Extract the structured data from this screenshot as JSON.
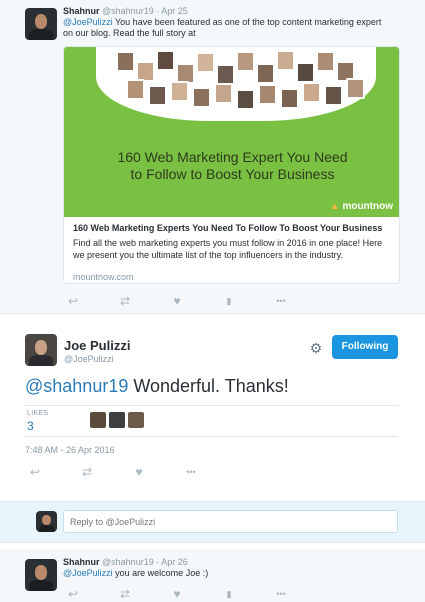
{
  "tweet1": {
    "name": "Shahnur",
    "handle": "@shahnur19",
    "separator": "·",
    "date": "Apr 25",
    "mention": "@JoePulizzi",
    "text_line1": " You have been featured as one of the top content marketing expert",
    "text_line2": "on our blog. Read the full story at",
    "card": {
      "image_headline_1": "160 Web Marketing Expert You Need",
      "image_headline_2": "to Follow to Boost Your Business",
      "brand": "mountnow",
      "brand_mark": "▲",
      "title": "160 Web Marketing Experts You Need To Follow To Boost Your Business",
      "description": "Find all the web marketing experts you must follow in 2016 in one place! Here we present you the ultimate list of the top influencers in the industry.",
      "domain": "mountnow.com"
    }
  },
  "main": {
    "name": "Joe Pulizzi",
    "handle": "@JoePulizzi",
    "follow_label": "Following",
    "mention": "@shahnur19",
    "text": " Wonderful.  Thanks!",
    "likes_label": "LIKES",
    "likes_count": "3",
    "timestamp": "7:48 AM - 26 Apr 2016"
  },
  "reply_box": {
    "placeholder": "Reply to @JoePulizzi"
  },
  "tweet2": {
    "name": "Shahnur",
    "handle": "@shahnur19",
    "separator": "·",
    "date": "Apr 26",
    "mention": "@JoePulizzi",
    "text": " you are welcome Joe :)"
  },
  "icons": {
    "reply": "↩",
    "retweet": "⇄",
    "like": "♥",
    "analytics": "▮",
    "more": "•••",
    "gear": "⚙"
  },
  "colors": {
    "link": "#2b7bb9",
    "follow_button": "#1b95e0",
    "card_green": "#7ac143"
  }
}
